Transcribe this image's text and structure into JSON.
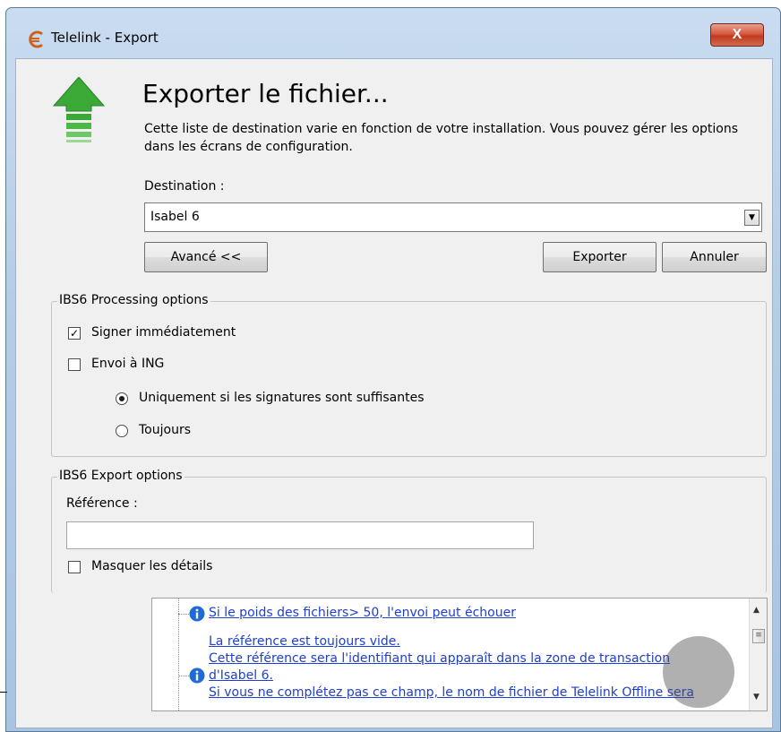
{
  "window": {
    "title": "Telelink - Export",
    "close_label": "X"
  },
  "header": {
    "heading": "Exporter le fichier...",
    "description": "Cette liste de destination varie en fonction de votre installation. Vous pouvez gérer les options dans les écrans de configuration."
  },
  "destination": {
    "label": "Destination :",
    "value": "Isabel 6"
  },
  "buttons": {
    "advanced": "Avancé <<",
    "export": "Exporter",
    "cancel": "Annuler"
  },
  "processing": {
    "legend": "IBS6 Processing options",
    "sign_now": {
      "label": "Signer immédiatement",
      "checked": true
    },
    "send_ing": {
      "label": "Envoi à ING",
      "checked": false
    },
    "radio_sufficient": {
      "label": "Uniquement si les signatures sont suffisantes",
      "selected": true
    },
    "radio_always": {
      "label": "Toujours",
      "selected": false
    }
  },
  "export_options": {
    "legend": "IBS6 Export options",
    "reference_label": "Référence :",
    "reference_value": "",
    "hide_details": {
      "label": "Masquer les détails",
      "checked": false
    }
  },
  "messages": [
    {
      "text": "Si le poids des fichiers> 50, l'envoi peut échouer"
    },
    {
      "lines": [
        "La référence est toujours vide.",
        "Cette référence sera l'identifiant qui apparaît dans la zone de transaction",
        "d'Isabel 6.",
        "Si vous ne complétez pas ce champ, le nom de fichier de Telelink Offline sera"
      ]
    }
  ],
  "colors": {
    "link": "#1f3fd1",
    "dialog_bg": "#f0f0f0",
    "close_button": "#c23a1e",
    "info_icon": "#1e6bd6",
    "arrow_green": "#3aa935"
  }
}
